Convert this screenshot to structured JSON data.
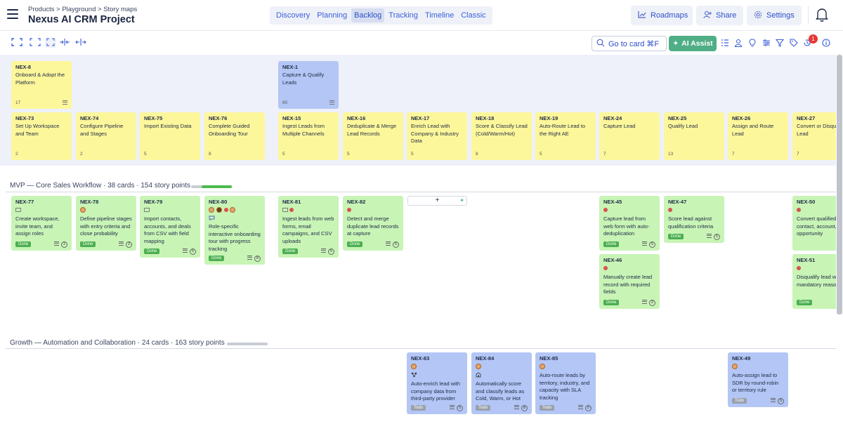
{
  "header": {
    "breadcrumb": "Products > Playground > Story maps",
    "title": "Nexus AI CRM Project",
    "tabs": [
      {
        "label": "Discovery",
        "active": false
      },
      {
        "label": "Planning",
        "active": false
      },
      {
        "label": "Backlog",
        "active": true
      },
      {
        "label": "Tracking",
        "active": false
      },
      {
        "label": "Timeline",
        "active": false
      },
      {
        "label": "Classic",
        "active": false
      }
    ],
    "roadmaps_label": "Roadmaps",
    "share_label": "Share",
    "settings_label": "Settings"
  },
  "toolbar": {
    "goto_label": "Go to card ⌘F",
    "ai_label": "AI Assist",
    "notification_count": "1"
  },
  "goals": [
    {
      "id": "NEX-8",
      "title": "Onboard & Adopt the Platform",
      "points": "17"
    },
    {
      "id": "NEX-1",
      "title": "Capture & Qualify Leads",
      "points": "60"
    }
  ],
  "activities": [
    {
      "id": "NEX-73",
      "title": "Set Up Workspace and Team",
      "points": "2"
    },
    {
      "id": "NEX-74",
      "title": "Configure Pipeline and Stages",
      "points": "2"
    },
    {
      "id": "NEX-75",
      "title": "Import Existing Data",
      "points": "5"
    },
    {
      "id": "NEX-76",
      "title": "Complete Guided Onboarding Tour",
      "points": "8"
    },
    {
      "id": "NEX-15",
      "title": "Ingest Leads from Multiple Channels",
      "points": "5"
    },
    {
      "id": "NEX-16",
      "title": "Deduplicate & Merge Lead Records",
      "points": "5"
    },
    {
      "id": "NEX-17",
      "title": "Enrich Lead with Company & Industry Data",
      "points": "5"
    },
    {
      "id": "NEX-18",
      "title": "Score & Classify Lead (Cold/Warm/Hot)",
      "points": "8"
    },
    {
      "id": "NEX-19",
      "title": "Auto-Route Lead to the Right AE",
      "points": "5"
    },
    {
      "id": "NEX-24",
      "title": "Capture Lead",
      "points": "7"
    },
    {
      "id": "NEX-25",
      "title": "Qualify Lead",
      "points": "13"
    },
    {
      "id": "NEX-26",
      "title": "Assign and Route Lead",
      "points": "7"
    },
    {
      "id": "NEX-27",
      "title": "Convert or Disqualify Lead",
      "points": "7"
    }
  ],
  "releases": [
    {
      "name": "MVP — Core Sales Workflow · 38 cards · 154 story points",
      "progress": 0.75
    },
    {
      "name": "Growth — Automation and Collaboration · 24 cards · 163 story points",
      "progress": 0.0
    }
  ],
  "mvp_cards": [
    {
      "id": "NEX-77",
      "body": "Create workspace, invite team, and assign roles",
      "status": "Done",
      "sp": "2"
    },
    {
      "id": "NEX-78",
      "body": "Define pipeline stages with entry criteria and close probability",
      "status": "Done",
      "sp": "2"
    },
    {
      "id": "NEX-79",
      "body": "Import contacts, accounts, and deals from CSV with field mapping",
      "status": "Done",
      "sp": "5"
    },
    {
      "id": "NEX-80",
      "body": "Role-specific interactive onboarding tour with progress tracking",
      "status": "Done",
      "sp": "8"
    },
    {
      "id": "NEX-81",
      "body": "Ingest leads from web forms, email campaigns, and CSV uploads",
      "status": "Done",
      "sp": "5"
    },
    {
      "id": "NEX-82",
      "body": "Detect and merge duplicate lead records at capture",
      "status": "Done",
      "sp": "5"
    },
    {
      "id": "NEX-45",
      "body": "Capture lead from web form with auto-deduplication",
      "status": "Done",
      "sp": "5"
    },
    {
      "id": "NEX-47",
      "body": "Score lead against qualification criteria",
      "status": "Done",
      "sp": "5"
    },
    {
      "id": "NEX-50",
      "body": "Convert qualified lead to contact, account, and opportunity",
      "status": "",
      "sp": ""
    },
    {
      "id": "NEX-46",
      "body": "Manually create lead record with required fields",
      "status": "Done",
      "sp": "2"
    },
    {
      "id": "NEX-51",
      "body": "Disqualify lead with mandatory reason code",
      "status": "Done",
      "sp": ""
    }
  ],
  "growth_cards": [
    {
      "id": "NEX-83",
      "body": "Auto-enrich lead with company data from third-party provider",
      "status": "Todo",
      "sp": "5"
    },
    {
      "id": "NEX-84",
      "body": "Automatically score and classify leads as Cold, Warm, or Hot",
      "status": "Todo",
      "sp": "8"
    },
    {
      "id": "NEX-85",
      "body": "Auto-route leads by territory, industry, and capacity with SLA tracking",
      "status": "Todo",
      "sp": "5"
    },
    {
      "id": "NEX-49",
      "body": "Auto-assign lead to SDR by round-robin or territory rule",
      "status": "Todo",
      "sp": "5"
    }
  ],
  "add_card_label": "+"
}
